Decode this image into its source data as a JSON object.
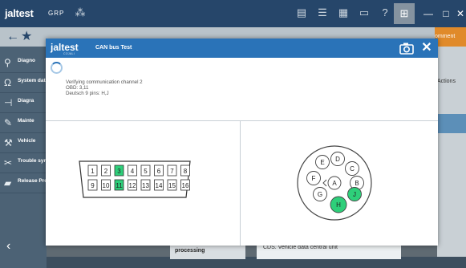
{
  "app": {
    "logo_text": "jaltest",
    "group_label": "GRP"
  },
  "sidebar": {
    "items": [
      {
        "label": "Diagno",
        "icon": "diagnosis-icon"
      },
      {
        "label": "System data",
        "icon": "ohm-icon"
      },
      {
        "label": "Diagra",
        "icon": "diagram-icon"
      },
      {
        "label": "Mainte",
        "icon": "maintenance-icon"
      },
      {
        "label": "Vehicle",
        "icon": "vehicle-icon"
      },
      {
        "label": "Trouble sympto",
        "icon": "trouble-icon"
      },
      {
        "label": "Release Proced",
        "icon": "release-icon"
      }
    ]
  },
  "background": {
    "orange_tab_label": "omment",
    "actions_label": "Actions",
    "cell_a": "processing",
    "cell_b": "CDS. Vehicle data central unit"
  },
  "modal": {
    "logo_text": "jaltest",
    "logo_sub": "COJALI",
    "title": "CAN bus Test",
    "close_glyph": "✕",
    "status": {
      "line1": "Verifying communication channel 2",
      "line2": "OBD: 3,11",
      "line3": "Deutsch 9 pins: H,J"
    },
    "obd": {
      "top_pins": [
        "1",
        "2",
        "3",
        "4",
        "5",
        "6",
        "7",
        "8"
      ],
      "bottom_pins": [
        "9",
        "10",
        "11",
        "12",
        "13",
        "14",
        "15",
        "16"
      ],
      "active_pins": [
        "3",
        "11"
      ]
    },
    "deutsch": {
      "pins": [
        "A",
        "B",
        "C",
        "D",
        "E",
        "F",
        "G",
        "H",
        "J"
      ],
      "active_pins": [
        "H",
        "J"
      ]
    }
  },
  "colors": {
    "header_blue": "#2a73b8",
    "active_green": "#2ecf7a",
    "topbar": "#26466a"
  }
}
